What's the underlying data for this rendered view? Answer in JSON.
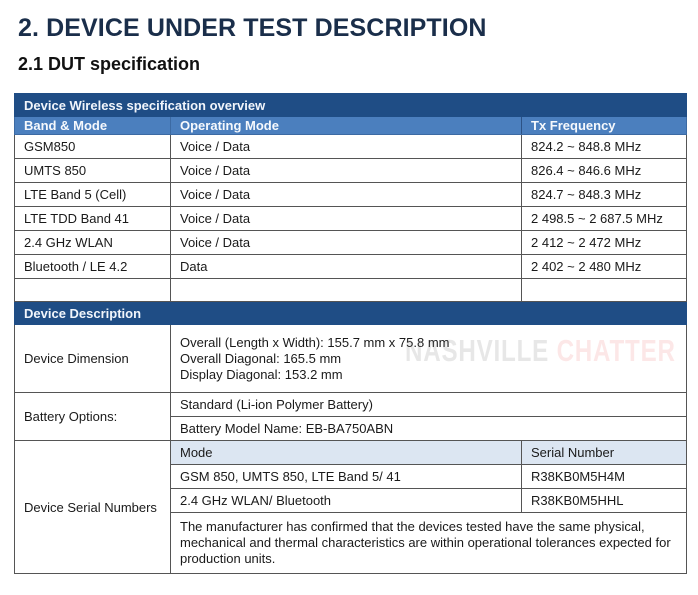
{
  "heading": "2. DEVICE UNDER TEST DESCRIPTION",
  "subheading": "2.1 DUT specification",
  "wireless": {
    "title": "Device Wireless specification overview",
    "columns": [
      "Band & Mode",
      "Operating Mode",
      "Tx Frequency"
    ],
    "rows": [
      [
        "GSM850",
        "Voice / Data",
        "824.2 ~ 848.8 MHz"
      ],
      [
        "UMTS 850",
        "Voice / Data",
        "826.4 ~ 846.6 MHz"
      ],
      [
        "LTE Band 5 (Cell)",
        "Voice / Data",
        "824.7 ~ 848.3 MHz"
      ],
      [
        "LTE TDD Band 41",
        "Voice / Data",
        "2 498.5 ~ 2 687.5 MHz"
      ],
      [
        "2.4 GHz WLAN",
        "Voice / Data",
        "2 412 ~ 2 472 MHz"
      ],
      [
        "Bluetooth / LE 4.2",
        "Data",
        "2 402 ~ 2 480 MHz"
      ]
    ]
  },
  "description": {
    "title": "Device Description",
    "dimension": {
      "label": "Device Dimension",
      "lines": [
        "Overall (Length x Width): 155.7 mm x 75.8 mm",
        "Overall Diagonal: 165.5 mm",
        "Display Diagonal: 153.2 mm"
      ]
    },
    "battery": {
      "label": "Battery Options:",
      "lines": [
        "Standard (Li-ion Polymer Battery)",
        "Battery Model Name: EB-BA750ABN"
      ]
    },
    "serials": {
      "label": "Device Serial Numbers",
      "columns": [
        "Mode",
        "Serial Number"
      ],
      "rows": [
        [
          "GSM 850, UMTS 850, LTE Band 5/ 41",
          "R38KB0M5H4M"
        ],
        [
          "2.4 GHz WLAN/ Bluetooth",
          "R38KB0M5HHL"
        ]
      ],
      "note": "The manufacturer has confirmed that the devices tested have the same physical, mechanical and thermal characteristics are within operational tolerances expected for production units."
    }
  },
  "watermark": {
    "part1": "NASHVILLE",
    "part2": "CHATTER"
  }
}
